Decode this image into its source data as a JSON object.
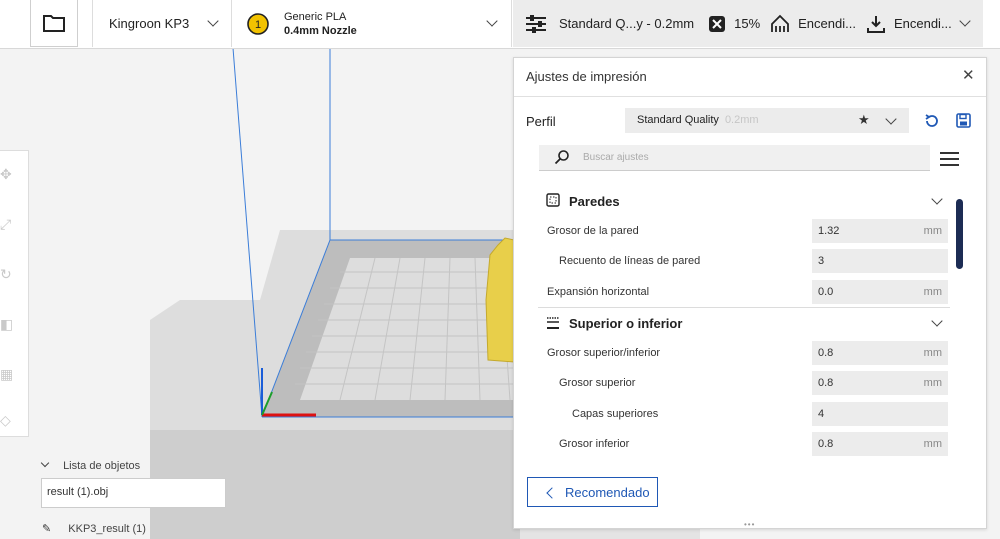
{
  "topbar": {
    "printer": "Kingroon KP3",
    "material": {
      "badge": "1",
      "name": "Generic PLA",
      "nozzle": "0.4mm Nozzle"
    },
    "print": {
      "profile": "Standard Q...y - 0.2mm",
      "infill": "15%",
      "support": "Encendi...",
      "adhesion": "Encendi..."
    }
  },
  "object_list": {
    "title": "Lista de objetos",
    "selected": "result (1).obj",
    "result_name": "KKP3_result (1)"
  },
  "panel": {
    "title": "Ajustes de impresión",
    "profile_label": "Perfil",
    "profile_name": "Standard Quality",
    "profile_sub": "0.2mm",
    "search_placeholder": "Buscar ajustes",
    "sections": [
      {
        "title": "Paredes"
      },
      {
        "title": "Superior o inferior"
      }
    ],
    "rows": [
      {
        "label": "Grosor de la pared",
        "value": "1.32",
        "unit": "mm"
      },
      {
        "label": "Recuento de líneas de pared",
        "value": "3",
        "unit": ""
      },
      {
        "label": "Expansión horizontal",
        "value": "0.0",
        "unit": "mm"
      },
      {
        "label": "Grosor superior/inferior",
        "value": "0.8",
        "unit": "mm"
      },
      {
        "label": "Grosor superior",
        "value": "0.8",
        "unit": "mm"
      },
      {
        "label": "Capas superiores",
        "value": "4",
        "unit": ""
      },
      {
        "label": "Grosor inferior",
        "value": "0.8",
        "unit": "mm"
      }
    ],
    "recommended_label": "Recomendado"
  },
  "colors": {
    "accent": "#1f58b5",
    "scroll_thumb": "#1c2c54",
    "model": "#e8cf4a",
    "badge": "#f2c200"
  }
}
